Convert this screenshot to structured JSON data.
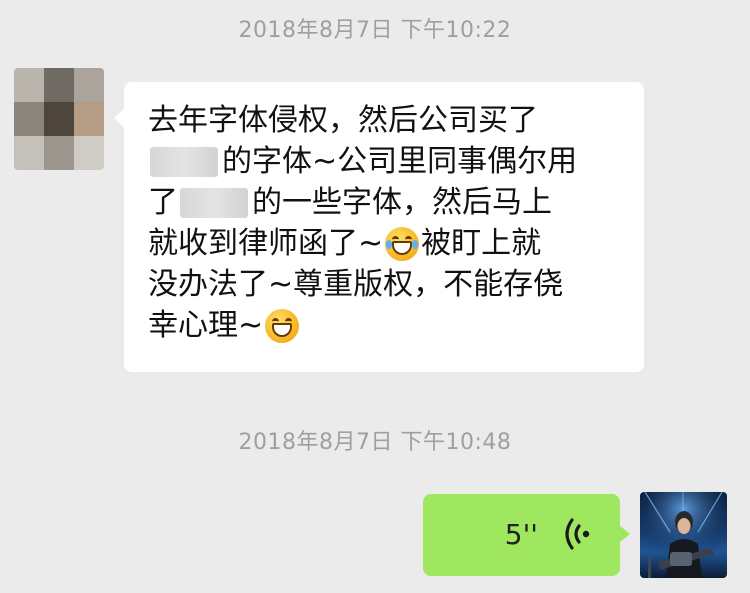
{
  "conversation": {
    "timestamps": [
      "2018年8月7日 下午10:22",
      "2018年8月7日 下午10:48"
    ],
    "incoming_message": {
      "lines": [
        {
          "pre": "去年字体侵权，然后公司买了"
        },
        {
          "pre": "",
          "post": "的字体~公司里同事偶尔用",
          "redacted": true
        },
        {
          "pre": "了",
          "post": "的一些字体，然后马上",
          "redacted": true
        },
        {
          "pre": "就收到律师函了~",
          "emoji": "crying-laughing-emoji",
          "post": "被盯上就"
        },
        {
          "pre": "没办法了~尊重版权，不能存侥"
        },
        {
          "pre": "幸心理~",
          "emoji": "grinning-emoji"
        }
      ]
    },
    "outgoing_message": {
      "type": "voice",
      "duration": "5''",
      "icon": "voice-wave-icon"
    }
  },
  "colors": {
    "background": "#ebebeb",
    "incoming_bubble": "#ffffff",
    "outgoing_bubble": "#9fe75f",
    "timestamp_text": "#9f9f9f"
  }
}
